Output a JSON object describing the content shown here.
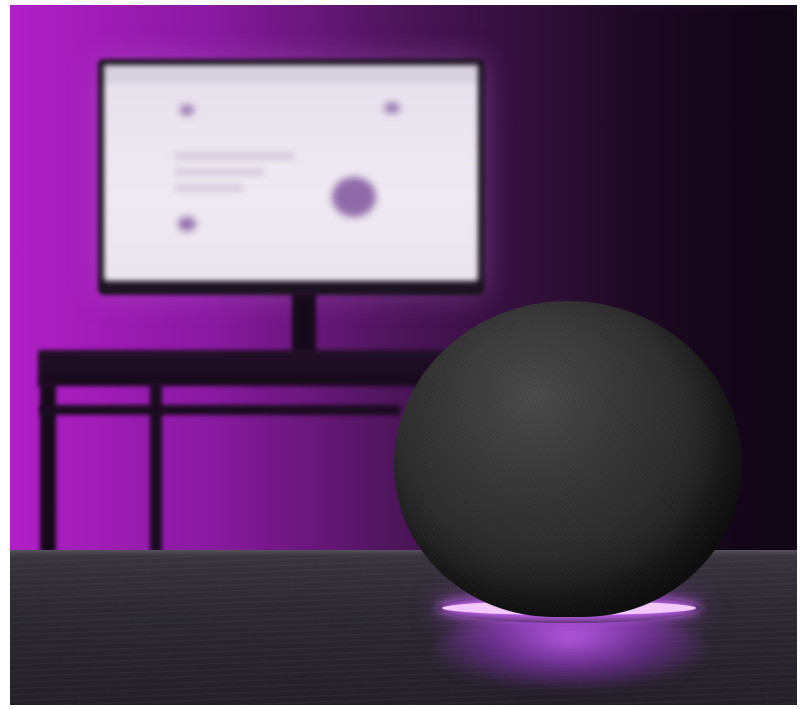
{
  "scene": {
    "subject": "smart-speaker",
    "colors": {
      "ambient_purple": "#b11fc7",
      "dark_wall": "#1e0c25",
      "speaker_fabric": "#2a2a2b",
      "light_ring": "#d070ff",
      "table": "#2c2931"
    }
  }
}
